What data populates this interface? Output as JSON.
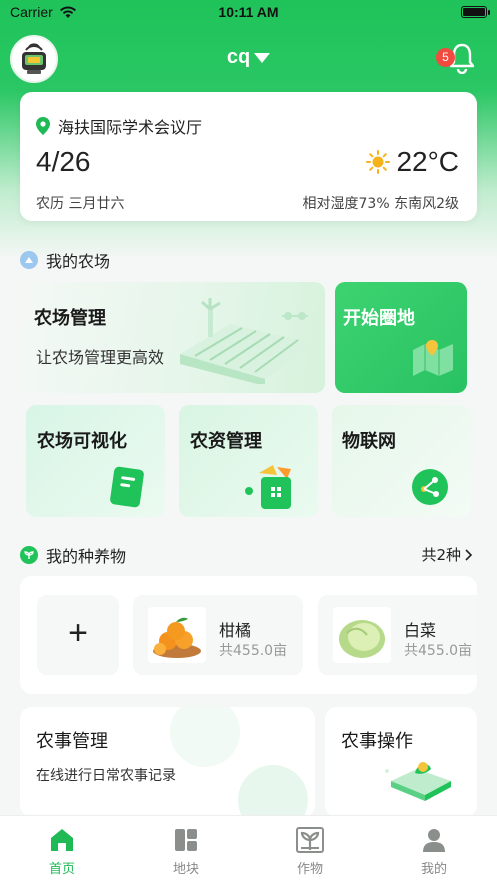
{
  "status_bar": {
    "carrier": "Carrier",
    "time": "10:11 AM"
  },
  "header": {
    "farm_name": "cq",
    "notification_count": "5"
  },
  "weather": {
    "location": "海扶国际学术会议厅",
    "date": "4/26",
    "temperature": "22°C",
    "lunar": "农历 三月廿六",
    "humidity_wind": "相对湿度73% 东南风2级"
  },
  "my_farm": {
    "section_title": "我的农场",
    "cards": [
      {
        "title": "农场管理",
        "subtitle": "让农场管理更高效"
      },
      {
        "title": "开始圈地"
      },
      {
        "title": "农场可视化"
      },
      {
        "title": "农资管理"
      },
      {
        "title": "物联网"
      }
    ]
  },
  "my_crops": {
    "section_title": "我的种养物",
    "count_label": "共2种",
    "add_label": "+",
    "items": [
      {
        "name": "柑橘",
        "area": "共455.0亩"
      },
      {
        "name": "白菜",
        "area": "共455.0亩"
      }
    ]
  },
  "farm_work": {
    "management": {
      "title": "农事管理",
      "subtitle": "在线进行日常农事记录"
    },
    "operation": {
      "title": "农事操作"
    }
  },
  "tabs": [
    {
      "label": "首页",
      "icon": "home-icon",
      "active": true
    },
    {
      "label": "地块",
      "icon": "plots-icon",
      "active": false
    },
    {
      "label": "作物",
      "icon": "crop-icon",
      "active": false
    },
    {
      "label": "我的",
      "icon": "profile-icon",
      "active": false
    }
  ],
  "colors": {
    "brand": "#1fc35a",
    "badge": "#f24a3e",
    "active_tab": "#1fb956"
  }
}
